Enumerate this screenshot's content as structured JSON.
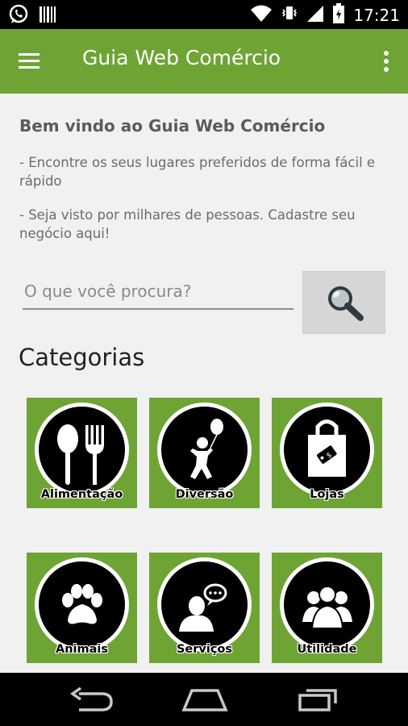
{
  "status_bar": {
    "time": "17:21",
    "icons": [
      "whatsapp-icon",
      "barcode-icon",
      "wifi-icon",
      "vibrate-icon",
      "signal-icon",
      "battery-icon"
    ]
  },
  "app_bar": {
    "title": "Guia Web Comércio",
    "color": "#6ea434",
    "icons": [
      "menu-icon",
      "more-vert-icon"
    ]
  },
  "main": {
    "welcome_title": "Bem vindo ao Guia Web Comércio",
    "paragraph1": "- Encontre os seus lugares preferidos de forma fácil e rápido",
    "paragraph2": "- Seja visto por milhares de pessoas. Cadastre seu negócio aqui!",
    "search": {
      "placeholder": "O que você procura?",
      "value": "",
      "button_icon": "search-icon"
    },
    "categories_title": "Categorias",
    "categories": [
      {
        "label": "Alimentação",
        "icon": "cutlery-icon"
      },
      {
        "label": "Diversão",
        "icon": "balloon-person-icon"
      },
      {
        "label": "Lojas",
        "icon": "shopping-bag-icon"
      },
      {
        "label": "Animais",
        "icon": "paw-icon"
      },
      {
        "label": "Serviços",
        "icon": "person-chat-icon"
      },
      {
        "label": "Utilidade",
        "icon": "people-group-icon"
      }
    ]
  },
  "nav_bar": {
    "icons": [
      "back-icon",
      "home-icon",
      "recents-icon"
    ]
  }
}
